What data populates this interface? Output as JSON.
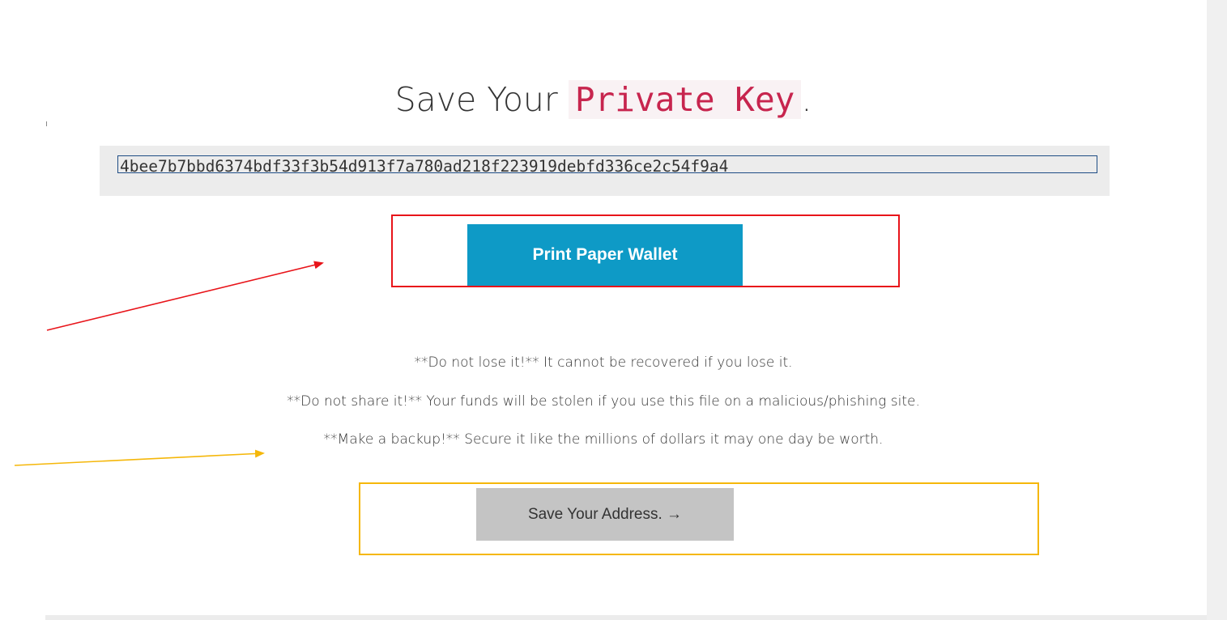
{
  "page": {
    "title_prefix": "Save Your",
    "title_key": "Private Key",
    "title_suffix": "."
  },
  "private_key": {
    "value": "4bee7b7bbd6374bdf33f3b54d913f7a780ad218f223919debfd336ce2c54f9a4"
  },
  "buttons": {
    "print_paper_wallet": "Print Paper Wallet",
    "save_address": "Save Your Address. →"
  },
  "warnings": [
    "**Do not lose it!** It cannot be recovered if you lose it.",
    "**Do not share it!** Your funds will be stolen if you use this file on a malicious/phishing site.",
    "**Make a backup!** Secure it like the millions of dollars it may one day be worth."
  ],
  "colors": {
    "accent_button": "#0e9ac6",
    "secondary_button": "#c4c4c4",
    "key_highlight": "#c7254e",
    "annotation_red": "#e8141a",
    "annotation_yellow": "#f5b70a",
    "input_border": "#1e4c84"
  },
  "annotations": [
    {
      "type": "arrow",
      "color": "red",
      "points_to": "print-paper-wallet-button"
    },
    {
      "type": "arrow",
      "color": "yellow",
      "points_to": "warning-backup"
    },
    {
      "type": "highlight-box",
      "color": "red",
      "surrounds": "print-paper-wallet-button"
    },
    {
      "type": "highlight-box",
      "color": "yellow",
      "surrounds": "save-address-button"
    }
  ]
}
